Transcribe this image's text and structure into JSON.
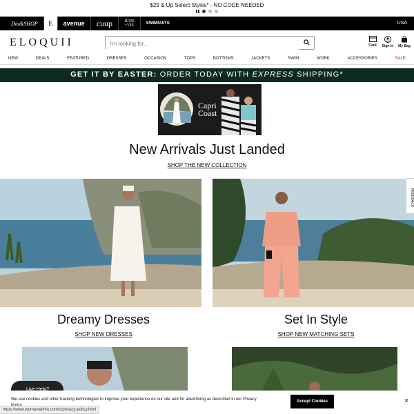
{
  "promo": {
    "text": "$29 & Up Select Styles* - NO CODE NEEDED"
  },
  "brands": {
    "b1": "Dia&SHOP",
    "b2": "E",
    "b3": "avenue",
    "b4": "cuup",
    "b5_line1": "JUNE",
    "b5_line2": "+VIE",
    "b6": "SWIMSUITS"
  },
  "region": "USA",
  "header": {
    "logo": "ELOQUII",
    "search_placeholder": "I'm looking for...",
    "card_label": "Card",
    "signin_label": "Sign In",
    "bag_label": "My Bag"
  },
  "nav": [
    "NEW",
    "DEALS",
    "FEATURED",
    "DRESSES",
    "OCCASION",
    "TOPS",
    "BOTTOMS",
    "JACKETS",
    "SWIM",
    "WORK",
    "ACCESSORIES",
    "SALE"
  ],
  "easter": {
    "bold": "GET IT BY EASTER:",
    "mid": " ORDER TODAY WITH ",
    "italic": "EXPRESS",
    "end": " SHIPPING*"
  },
  "banner": {
    "line1": "Capri",
    "line2": "Coast"
  },
  "arrivals": {
    "title": "New Arrivals Just Landed",
    "link": "SHOP THE NEW COLLECTION"
  },
  "tiles": [
    {
      "title": "Dreamy Dresses",
      "link": "SHOP NEW DRESSES"
    },
    {
      "title": "Set In Style",
      "link": "SHOP NEW MATCHING SETS"
    }
  ],
  "feedback": "FEEDBACK",
  "chat": "Live Help?",
  "cookie": {
    "text": "We use cookies and other tracking technologies to improve your experience on our site and for advertising as described in our Privacy Policy.",
    "accept": "Accept Cookies",
    "close": "×"
  },
  "status_url": "https://www.womanwithin.com/c/privacy-policy.html",
  "colors": {
    "easter_bg": "#0c2a1f",
    "sale": "#c8102e",
    "brandbar": "#000000"
  }
}
